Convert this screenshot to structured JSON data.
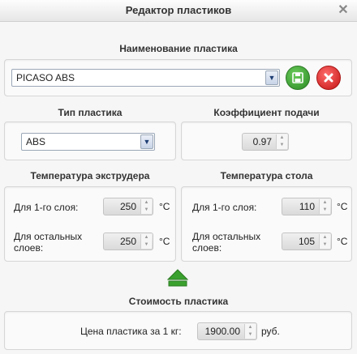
{
  "window": {
    "title": "Редактор пластиков",
    "close_glyph": "✕"
  },
  "name_section": {
    "label": "Наименование пластика",
    "selected": "PICASO ABS",
    "save_icon": "floppy-disk-icon",
    "delete_icon": "close-icon"
  },
  "type_section": {
    "label": "Тип пластика",
    "selected": "ABS"
  },
  "feed_section": {
    "label": "Коэффициент подачи",
    "value": "0.97"
  },
  "extruder": {
    "label": "Температура экструдера",
    "first_label": "Для 1-го слоя:",
    "first_value": "250",
    "rest_label_1": "Для остальных",
    "rest_label_2": "слоев:",
    "rest_value": "250",
    "unit": "°C"
  },
  "bed": {
    "label": "Температура стола",
    "first_label": "Для 1-го слоя:",
    "first_value": "110",
    "rest_label_1": "Для остальных",
    "rest_label_2": "слоев:",
    "rest_value": "105",
    "unit": "°C"
  },
  "cost": {
    "label": "Стоимость пластика",
    "price_label": "Цена пластика за 1 кг:",
    "price_value": "1900.00",
    "currency": "руб."
  },
  "colors": {
    "accent_green": "#3aa12e",
    "delete_red": "#d91b1b"
  }
}
